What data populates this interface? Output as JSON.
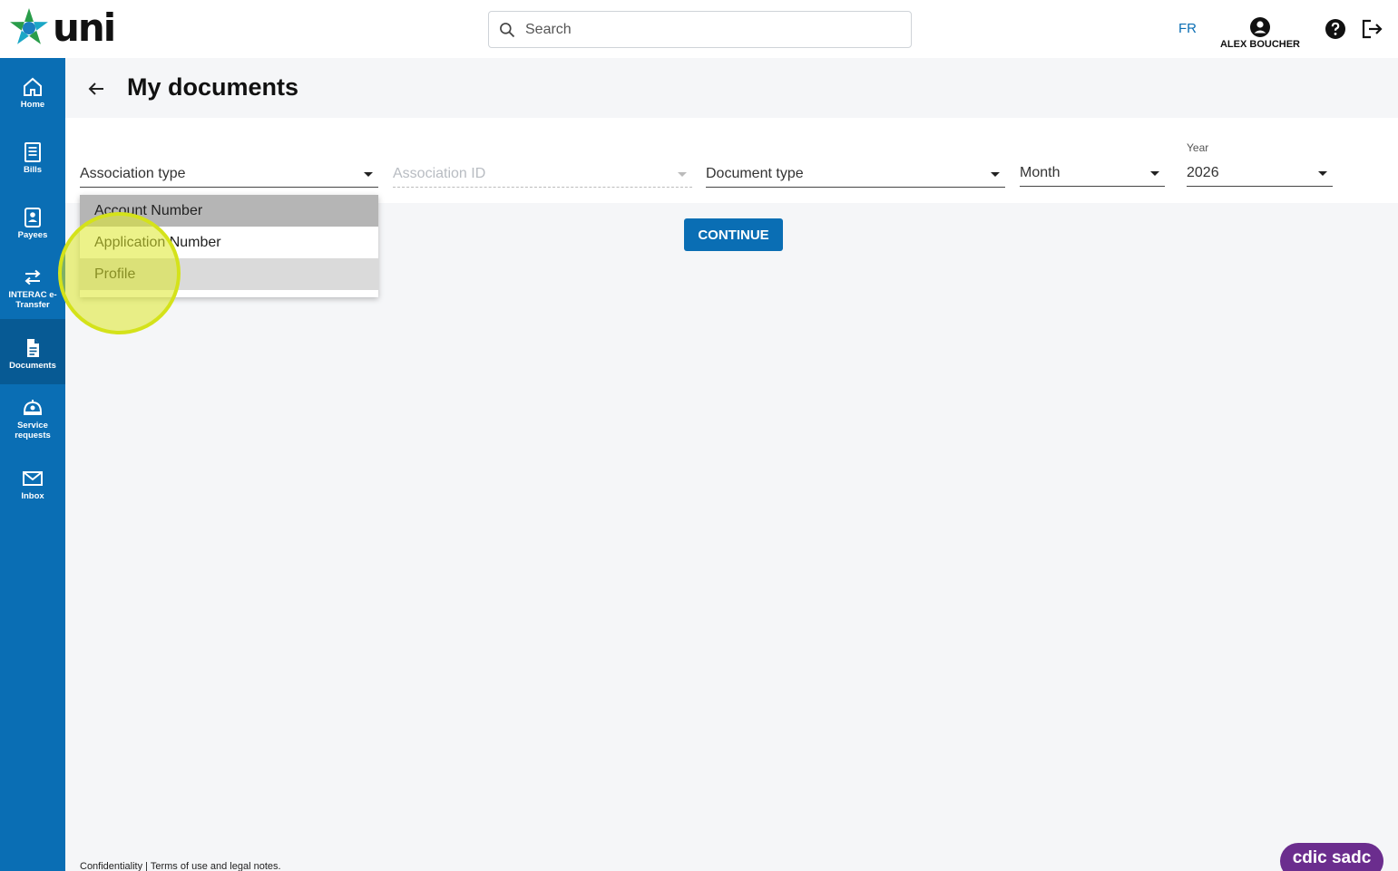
{
  "brand": {
    "logo_text": "uni",
    "primary": "#0a6eb4",
    "green": "#2a9d4a",
    "teal": "#1ba7c6"
  },
  "header": {
    "search_placeholder": "Search",
    "lang": "FR",
    "user_name": "ALEX BOUCHER"
  },
  "sidebar": {
    "items": [
      {
        "label": "Home",
        "icon": "home-icon"
      },
      {
        "label": "Bills",
        "icon": "receipt-icon"
      },
      {
        "label": "Payees",
        "icon": "contacts-icon"
      },
      {
        "label": "INTERAC e-Transfer",
        "icon": "transfer-arrows-icon"
      },
      {
        "label": "Documents",
        "icon": "document-icon",
        "active": true
      },
      {
        "label": "Service requests",
        "icon": "service-icon"
      },
      {
        "label": "Inbox",
        "icon": "mail-icon"
      }
    ]
  },
  "page": {
    "title": "My documents"
  },
  "filters": {
    "association_type": "Association type",
    "association_id": "Association ID",
    "document_type": "Document type",
    "month": "Month",
    "year_label": "Year",
    "year_value": "2026"
  },
  "dropdown": {
    "options": [
      "Account Number",
      "Application Number",
      "Profile"
    ],
    "selected": "Account Number",
    "hovered": "Profile"
  },
  "actions": {
    "continue": "CONTINUE"
  },
  "footer": {
    "text": "Confidentiality | Terms of use and legal notes.",
    "badge": "cdic sadc"
  }
}
